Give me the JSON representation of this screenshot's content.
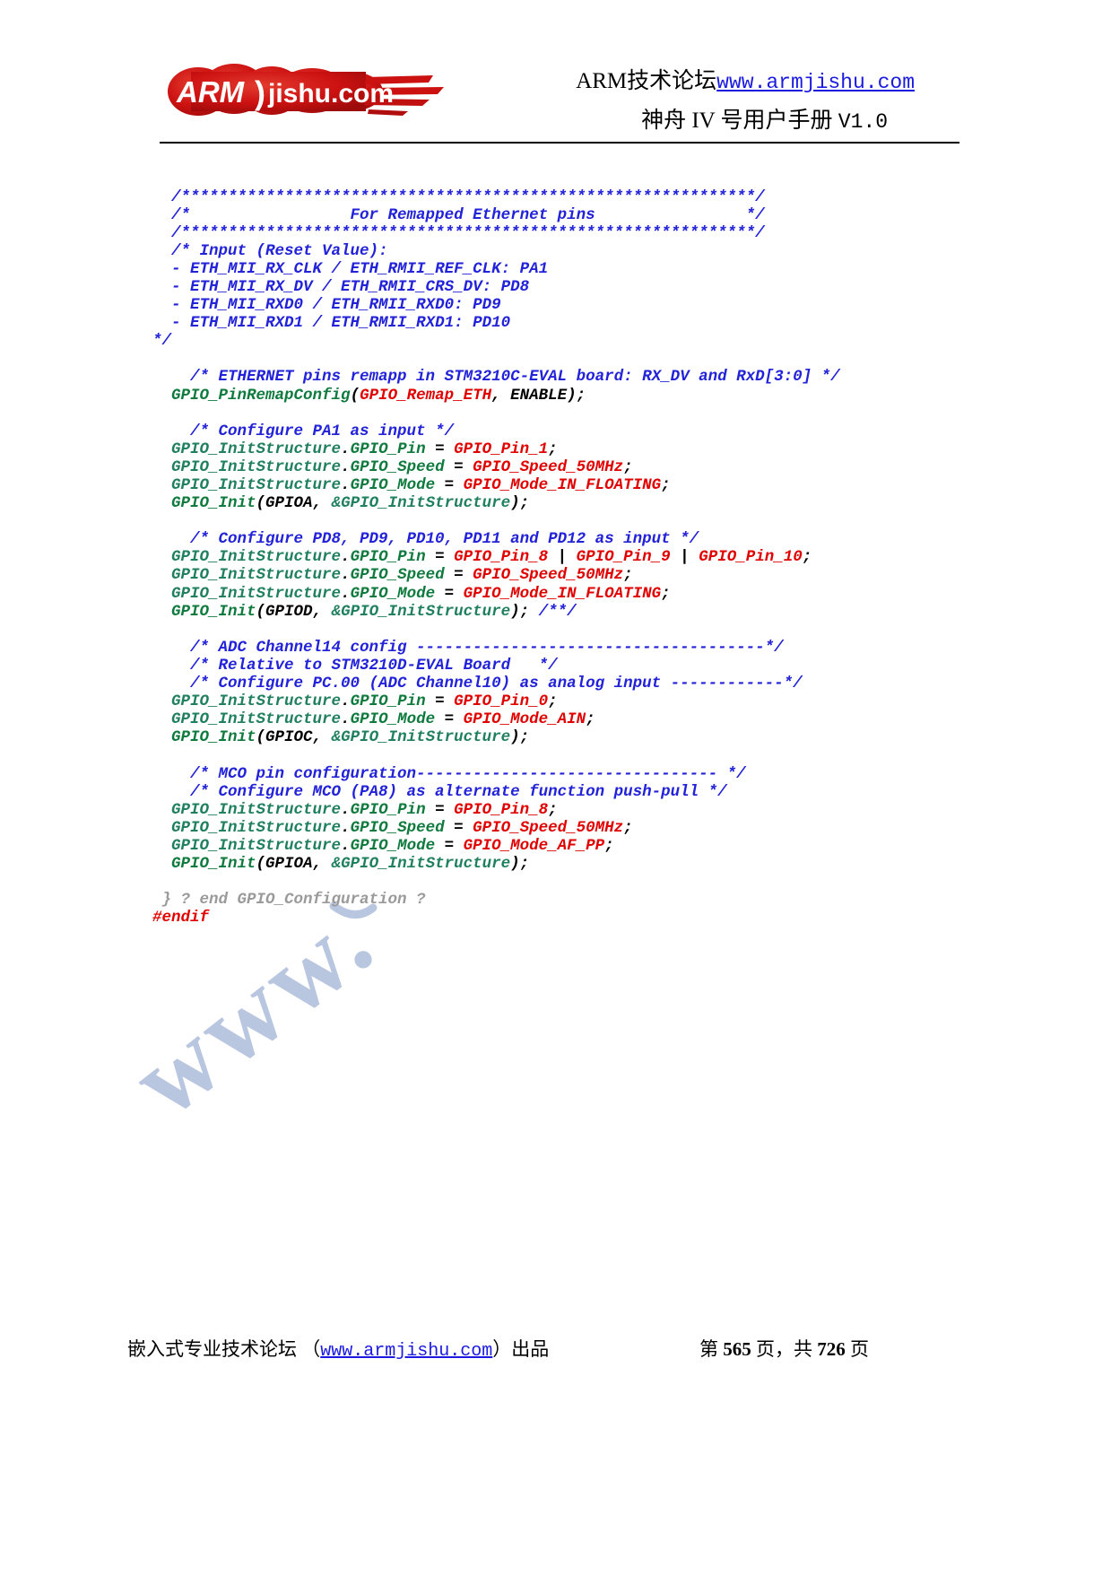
{
  "header": {
    "logo_alt": "ARM jishu.com",
    "logo_text_arm": "ARM",
    "logo_text_site": "jishu.com",
    "title_prefix": "ARM技术论坛",
    "title_url": "www.armjishu.com",
    "subtitle": "神舟 IV 号用户手册",
    "version": "V1.0"
  },
  "watermark": {
    "text": "www."
  },
  "code": {
    "lines": [
      [
        {
          "t": "  ",
          "c": "plain"
        },
        {
          "t": "/*************************************************************/",
          "c": "cmt"
        }
      ],
      [
        {
          "t": "  ",
          "c": "plain"
        },
        {
          "t": "/*                 For Remapped Ethernet pins                */",
          "c": "cmt"
        }
      ],
      [
        {
          "t": "  ",
          "c": "plain"
        },
        {
          "t": "/*************************************************************/",
          "c": "cmt"
        }
      ],
      [
        {
          "t": "  ",
          "c": "plain"
        },
        {
          "t": "/* Input (Reset Value):",
          "c": "cmt"
        }
      ],
      [
        {
          "t": "  ",
          "c": "plain"
        },
        {
          "t": "- ETH_MII_RX_CLK / ETH_RMII_REF_CLK: PA1",
          "c": "cmt"
        }
      ],
      [
        {
          "t": "  ",
          "c": "plain"
        },
        {
          "t": "- ETH_MII_RX_DV / ETH_RMII_CRS_DV: PD8",
          "c": "cmt"
        }
      ],
      [
        {
          "t": "  ",
          "c": "plain"
        },
        {
          "t": "- ETH_MII_RXD0 / ETH_RMII_RXD0: PD9",
          "c": "cmt"
        }
      ],
      [
        {
          "t": "  ",
          "c": "plain"
        },
        {
          "t": "- ETH_MII_RXD1 / ETH_RMII_RXD1: PD10",
          "c": "cmt"
        }
      ],
      [
        {
          "t": "*/",
          "c": "cmt"
        }
      ],
      [
        {
          "t": "",
          "c": "plain"
        }
      ],
      [
        {
          "t": "    ",
          "c": "plain"
        },
        {
          "t": "/* ETHERNET pins remapp in STM3210C-EVAL board: RX_DV and RxD[3:0] */",
          "c": "cmt"
        }
      ],
      [
        {
          "t": "  ",
          "c": "plain"
        },
        {
          "t": "GPIO_PinRemapConfig",
          "c": "fn"
        },
        {
          "t": "(",
          "c": "kw"
        },
        {
          "t": "GPIO_Remap_ETH",
          "c": "cst"
        },
        {
          "t": ", ",
          "c": "kw"
        },
        {
          "t": "ENABLE",
          "c": "kw"
        },
        {
          "t": ");",
          "c": "kw"
        }
      ],
      [
        {
          "t": "",
          "c": "plain"
        }
      ],
      [
        {
          "t": "    ",
          "c": "plain"
        },
        {
          "t": "/* Configure PA1 as input */",
          "c": "cmt"
        }
      ],
      [
        {
          "t": "  ",
          "c": "plain"
        },
        {
          "t": "GPIO_InitStructure",
          "c": "id"
        },
        {
          "t": ".",
          "c": "kw"
        },
        {
          "t": "GPIO_Pin",
          "c": "fn"
        },
        {
          "t": " = ",
          "c": "kw"
        },
        {
          "t": "GPIO_Pin_1",
          "c": "cst"
        },
        {
          "t": ";",
          "c": "kw"
        }
      ],
      [
        {
          "t": "  ",
          "c": "plain"
        },
        {
          "t": "GPIO_InitStructure",
          "c": "id"
        },
        {
          "t": ".",
          "c": "kw"
        },
        {
          "t": "GPIO_Speed",
          "c": "fn"
        },
        {
          "t": " = ",
          "c": "kw"
        },
        {
          "t": "GPIO_Speed_50MHz",
          "c": "cst"
        },
        {
          "t": ";",
          "c": "kw"
        }
      ],
      [
        {
          "t": "  ",
          "c": "plain"
        },
        {
          "t": "GPIO_InitStructure",
          "c": "id"
        },
        {
          "t": ".",
          "c": "kw"
        },
        {
          "t": "GPIO_Mode",
          "c": "fn"
        },
        {
          "t": " = ",
          "c": "kw"
        },
        {
          "t": "GPIO_Mode_IN_FLOATING",
          "c": "cst"
        },
        {
          "t": ";",
          "c": "kw"
        }
      ],
      [
        {
          "t": "  ",
          "c": "plain"
        },
        {
          "t": "GPIO_Init",
          "c": "fn"
        },
        {
          "t": "(",
          "c": "kw"
        },
        {
          "t": "GPIOA",
          "c": "kw"
        },
        {
          "t": ", ",
          "c": "kw"
        },
        {
          "t": "&GPIO_InitStructure",
          "c": "id"
        },
        {
          "t": ");",
          "c": "kw"
        }
      ],
      [
        {
          "t": "",
          "c": "plain"
        }
      ],
      [
        {
          "t": "    ",
          "c": "plain"
        },
        {
          "t": "/* Configure PD8, PD9, PD10, PD11 and PD12 as input */",
          "c": "cmt"
        }
      ],
      [
        {
          "t": "  ",
          "c": "plain"
        },
        {
          "t": "GPIO_InitStructure",
          "c": "id"
        },
        {
          "t": ".",
          "c": "kw"
        },
        {
          "t": "GPIO_Pin",
          "c": "fn"
        },
        {
          "t": " = ",
          "c": "kw"
        },
        {
          "t": "GPIO_Pin_8",
          "c": "cst"
        },
        {
          "t": " | ",
          "c": "kw"
        },
        {
          "t": "GPIO_Pin_9",
          "c": "cst"
        },
        {
          "t": " | ",
          "c": "kw"
        },
        {
          "t": "GPIO_Pin_10",
          "c": "cst"
        },
        {
          "t": ";",
          "c": "kw"
        }
      ],
      [
        {
          "t": "  ",
          "c": "plain"
        },
        {
          "t": "GPIO_InitStructure",
          "c": "id"
        },
        {
          "t": ".",
          "c": "kw"
        },
        {
          "t": "GPIO_Speed",
          "c": "fn"
        },
        {
          "t": " = ",
          "c": "kw"
        },
        {
          "t": "GPIO_Speed_50MHz",
          "c": "cst"
        },
        {
          "t": ";",
          "c": "kw"
        }
      ],
      [
        {
          "t": "  ",
          "c": "plain"
        },
        {
          "t": "GPIO_InitStructure",
          "c": "id"
        },
        {
          "t": ".",
          "c": "kw"
        },
        {
          "t": "GPIO_Mode",
          "c": "fn"
        },
        {
          "t": " = ",
          "c": "kw"
        },
        {
          "t": "GPIO_Mode_IN_FLOATING",
          "c": "cst"
        },
        {
          "t": ";",
          "c": "kw"
        }
      ],
      [
        {
          "t": "  ",
          "c": "plain"
        },
        {
          "t": "GPIO_Init",
          "c": "fn"
        },
        {
          "t": "(",
          "c": "kw"
        },
        {
          "t": "GPIOD",
          "c": "kw"
        },
        {
          "t": ", ",
          "c": "kw"
        },
        {
          "t": "&GPIO_InitStructure",
          "c": "id"
        },
        {
          "t": "); ",
          "c": "kw"
        },
        {
          "t": "/**/",
          "c": "cmt"
        }
      ],
      [
        {
          "t": "",
          "c": "plain"
        }
      ],
      [
        {
          "t": "    ",
          "c": "plain"
        },
        {
          "t": "/* ADC Channel14 config -------------------------------------*/",
          "c": "cmt"
        }
      ],
      [
        {
          "t": "    ",
          "c": "plain"
        },
        {
          "t": "/* Relative to STM3210D-EVAL Board   */",
          "c": "cmt"
        }
      ],
      [
        {
          "t": "    ",
          "c": "plain"
        },
        {
          "t": "/* Configure PC.00 (ADC Channel10) as analog input ------------*/",
          "c": "cmt"
        }
      ],
      [
        {
          "t": "  ",
          "c": "plain"
        },
        {
          "t": "GPIO_InitStructure",
          "c": "id"
        },
        {
          "t": ".",
          "c": "kw"
        },
        {
          "t": "GPIO_Pin",
          "c": "fn"
        },
        {
          "t": " = ",
          "c": "kw"
        },
        {
          "t": "GPIO_Pin_0",
          "c": "cst"
        },
        {
          "t": ";",
          "c": "kw"
        }
      ],
      [
        {
          "t": "  ",
          "c": "plain"
        },
        {
          "t": "GPIO_InitStructure",
          "c": "id"
        },
        {
          "t": ".",
          "c": "kw"
        },
        {
          "t": "GPIO_Mode",
          "c": "fn"
        },
        {
          "t": " = ",
          "c": "kw"
        },
        {
          "t": "GPIO_Mode_AIN",
          "c": "cst"
        },
        {
          "t": ";",
          "c": "kw"
        }
      ],
      [
        {
          "t": "  ",
          "c": "plain"
        },
        {
          "t": "GPIO_Init",
          "c": "fn"
        },
        {
          "t": "(",
          "c": "kw"
        },
        {
          "t": "GPIOC",
          "c": "kw"
        },
        {
          "t": ", ",
          "c": "kw"
        },
        {
          "t": "&GPIO_InitStructure",
          "c": "id"
        },
        {
          "t": ");",
          "c": "kw"
        }
      ],
      [
        {
          "t": "",
          "c": "plain"
        }
      ],
      [
        {
          "t": "    ",
          "c": "plain"
        },
        {
          "t": "/* MCO pin configuration-------------------------------- */",
          "c": "cmt"
        }
      ],
      [
        {
          "t": "    ",
          "c": "plain"
        },
        {
          "t": "/* Configure MCO (PA8) as alternate function push-pull */",
          "c": "cmt"
        }
      ],
      [
        {
          "t": "  ",
          "c": "plain"
        },
        {
          "t": "GPIO_InitStructure",
          "c": "id"
        },
        {
          "t": ".",
          "c": "kw"
        },
        {
          "t": "GPIO_Pin",
          "c": "fn"
        },
        {
          "t": " = ",
          "c": "kw"
        },
        {
          "t": "GPIO_Pin_8",
          "c": "cst"
        },
        {
          "t": ";",
          "c": "kw"
        }
      ],
      [
        {
          "t": "  ",
          "c": "plain"
        },
        {
          "t": "GPIO_InitStructure",
          "c": "id"
        },
        {
          "t": ".",
          "c": "kw"
        },
        {
          "t": "GPIO_Speed",
          "c": "fn"
        },
        {
          "t": " = ",
          "c": "kw"
        },
        {
          "t": "GPIO_Speed_50MHz",
          "c": "cst"
        },
        {
          "t": ";",
          "c": "kw"
        }
      ],
      [
        {
          "t": "  ",
          "c": "plain"
        },
        {
          "t": "GPIO_InitStructure",
          "c": "id"
        },
        {
          "t": ".",
          "c": "kw"
        },
        {
          "t": "GPIO_Mode",
          "c": "fn"
        },
        {
          "t": " = ",
          "c": "kw"
        },
        {
          "t": "GPIO_Mode_AF_PP",
          "c": "cst"
        },
        {
          "t": ";",
          "c": "kw"
        }
      ],
      [
        {
          "t": "  ",
          "c": "plain"
        },
        {
          "t": "GPIO_Init",
          "c": "fn"
        },
        {
          "t": "(",
          "c": "kw"
        },
        {
          "t": "GPIOA",
          "c": "kw"
        },
        {
          "t": ", ",
          "c": "kw"
        },
        {
          "t": "&GPIO_InitStructure",
          "c": "id"
        },
        {
          "t": ");",
          "c": "kw"
        }
      ],
      [
        {
          "t": "",
          "c": "plain"
        }
      ],
      [
        {
          "t": " } ? end GPIO_Configuration ?",
          "c": "grey"
        }
      ],
      [
        {
          "t": "#endif",
          "c": "pre"
        }
      ]
    ]
  },
  "footer": {
    "left_prefix": "嵌入式专业技术论坛 （",
    "left_url": "www.armjishu.com",
    "left_suffix": "）出品",
    "page_prefix": "第 ",
    "page_number": "565",
    "page_mid": " 页，共 ",
    "page_total": "726",
    "page_suffix": " 页"
  },
  "colors": {
    "comment": "#2222d8",
    "function": "#0f7a3d",
    "identifier": "#1f7f5e",
    "constant": "#e00000",
    "keyword": "#000000",
    "grey": "#9a9a9a",
    "link": "#1a1ae0",
    "logo_red": "#cc1111",
    "watermark": "#b9c6e0"
  }
}
